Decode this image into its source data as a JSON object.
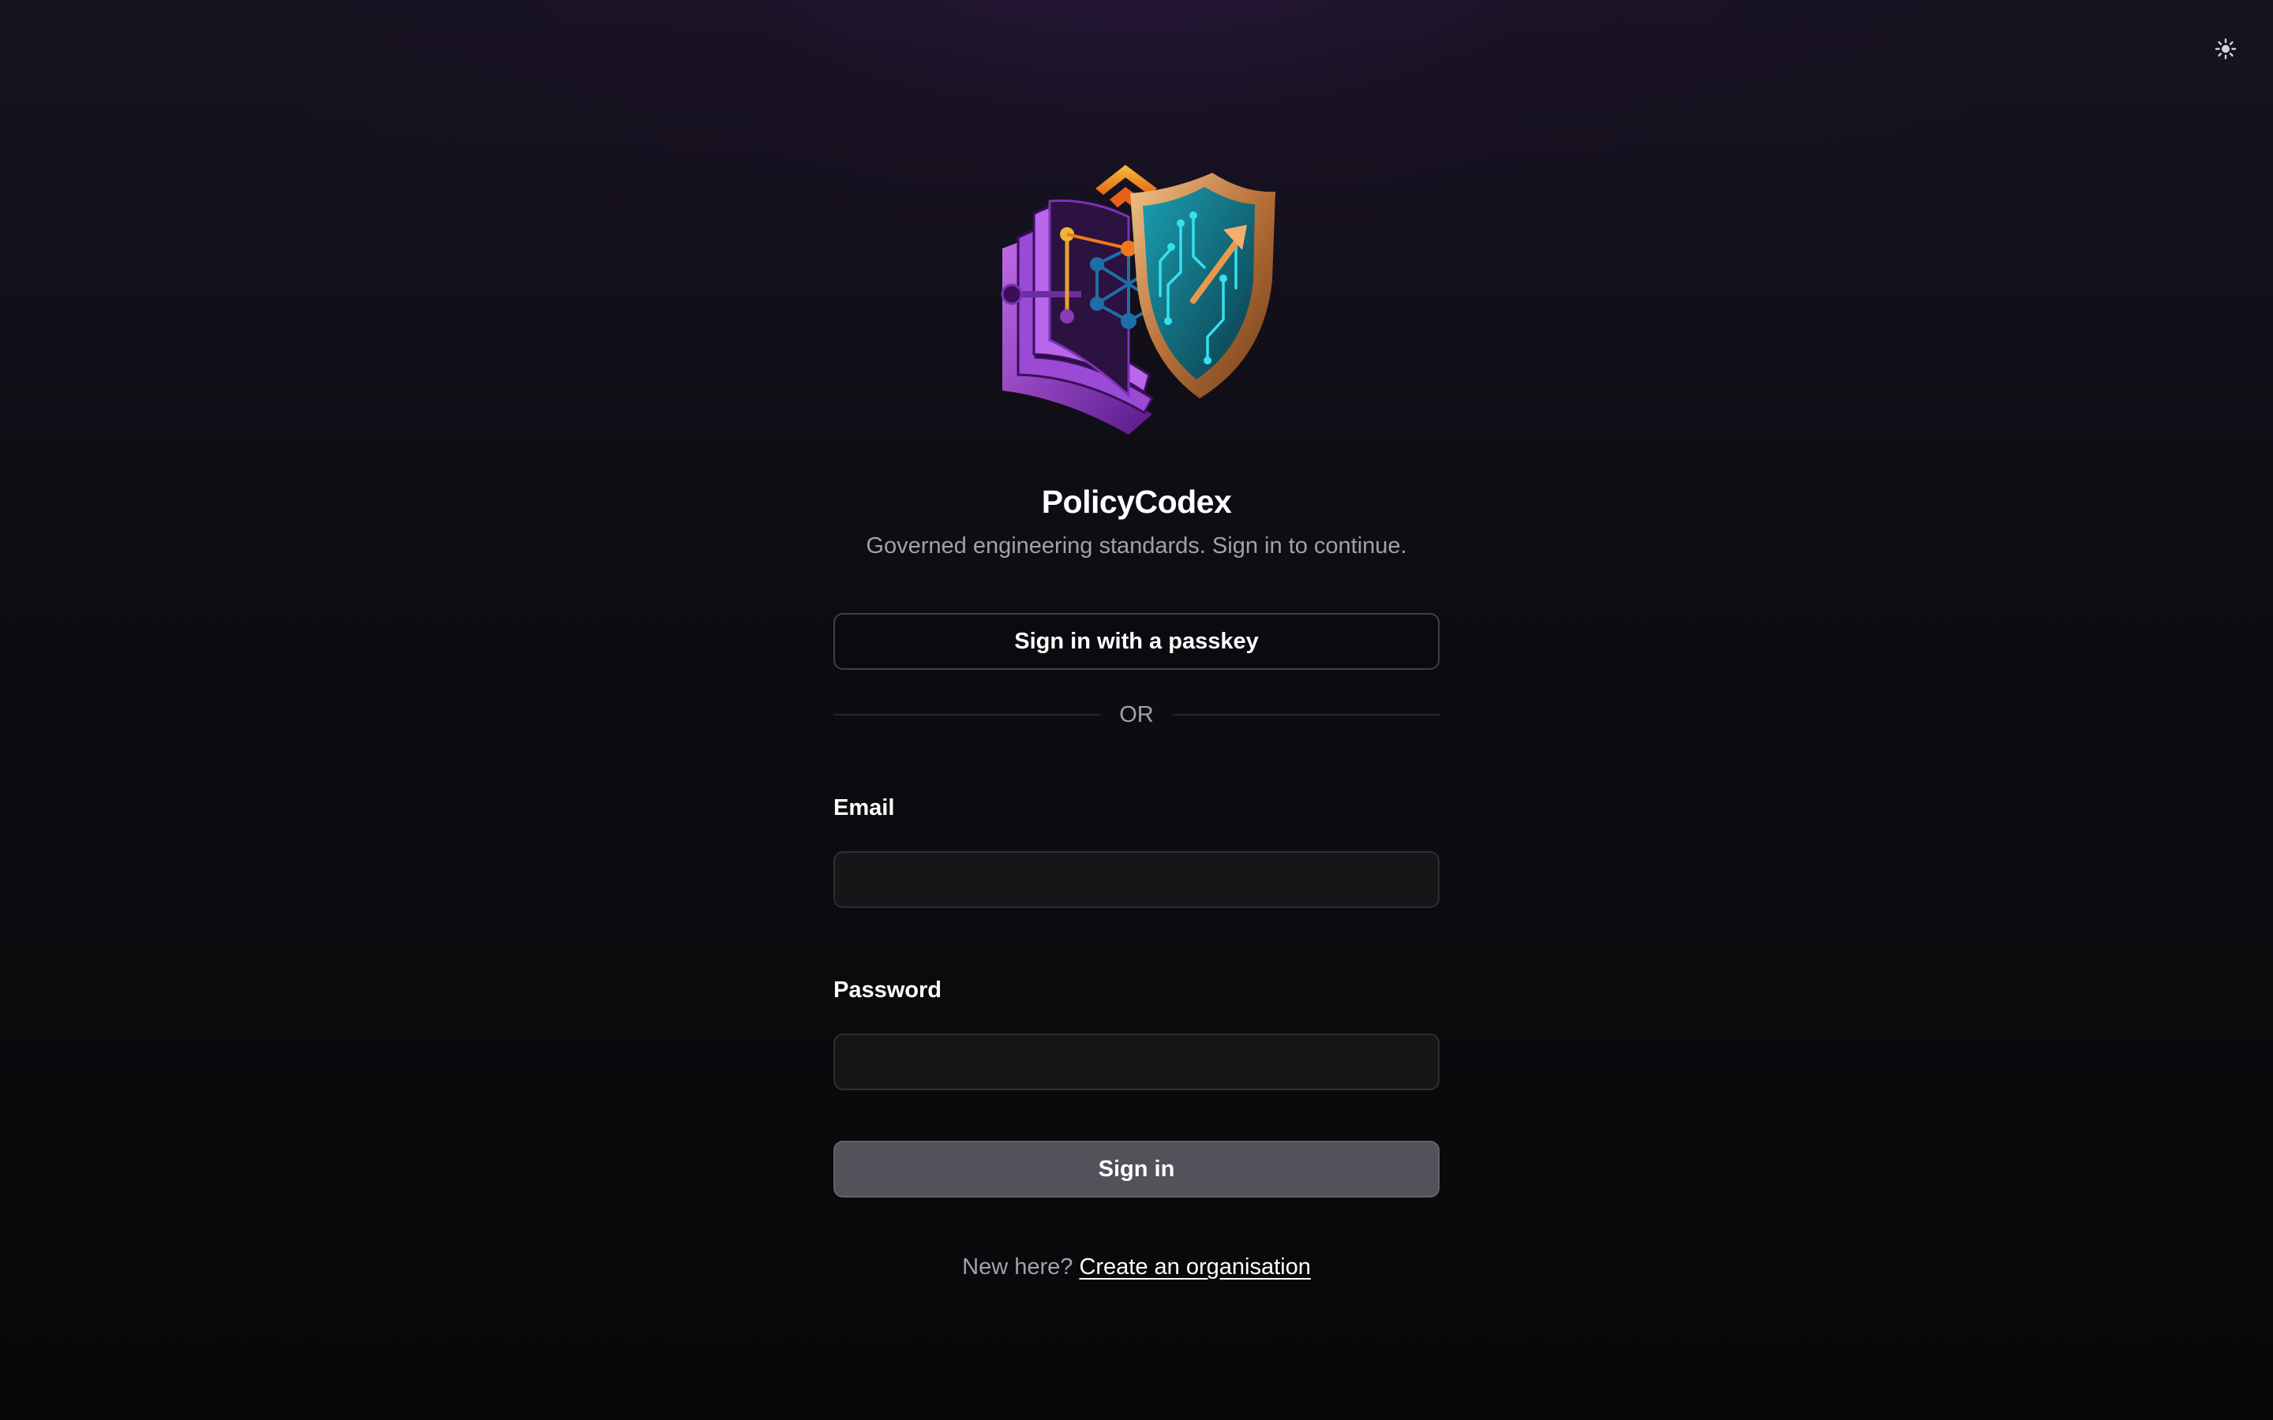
{
  "theme_toggle": {
    "icon": "sun-icon",
    "glyph": "☀"
  },
  "brand": {
    "logo": "policycodex-logo",
    "title": "PolicyCodex",
    "subtitle": "Governed engineering standards. Sign in to continue."
  },
  "auth": {
    "passkey_button": "Sign in with a passkey",
    "divider": "OR",
    "email_label": "Email",
    "email_value": "",
    "password_label": "Password",
    "password_value": "",
    "submit_button": "Sign in"
  },
  "footer": {
    "prompt": "New here?",
    "link": "Create an organisation"
  },
  "colors": {
    "background": "#0b0b0e",
    "accent_purple": "#8e3fc8",
    "accent_cyan": "#1fc8d8",
    "accent_orange": "#f07a1a",
    "accent_gold": "#e6a82a",
    "button_primary": "#52525b"
  }
}
